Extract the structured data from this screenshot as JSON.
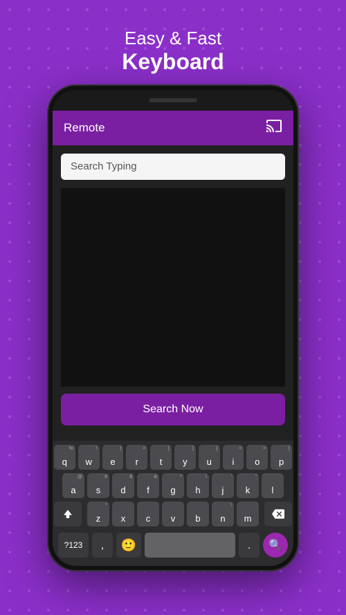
{
  "header": {
    "line1": "Easy & Fast",
    "line2": "Keyboard"
  },
  "appBar": {
    "title": "Remote"
  },
  "searchInput": {
    "placeholder": "Search Typing"
  },
  "searchButton": {
    "label": "Search Now"
  },
  "keyboard": {
    "row1": [
      {
        "label": "q",
        "sub": "%"
      },
      {
        "label": "w",
        "sub": "\\"
      },
      {
        "label": "e",
        "sub": "|"
      },
      {
        "label": "r",
        "sub": "="
      },
      {
        "label": "t",
        "sub": "["
      },
      {
        "label": "y",
        "sub": "]"
      },
      {
        "label": "u",
        "sub": "{"
      },
      {
        "label": "i",
        "sub": "<"
      },
      {
        "label": "o",
        "sub": ">"
      },
      {
        "label": "p",
        "sub": "}"
      }
    ],
    "row2": [
      {
        "label": "a",
        "sub": "@"
      },
      {
        "label": "s",
        "sub": "#"
      },
      {
        "label": "d",
        "sub": "$"
      },
      {
        "label": "f",
        "sub": "&"
      },
      {
        "label": "g",
        "sub": "*"
      },
      {
        "label": "h",
        "sub": "\\"
      },
      {
        "label": "j",
        "sub": "'"
      },
      {
        "label": "k",
        "sub": "\""
      },
      {
        "label": "l",
        "sub": ""
      }
    ],
    "row3": [
      {
        "label": "z",
        "sub": "*"
      },
      {
        "label": "x",
        "sub": ""
      },
      {
        "label": "c",
        "sub": ""
      },
      {
        "label": "v",
        "sub": ""
      },
      {
        "label": "b",
        "sub": ""
      },
      {
        "label": "n",
        "sub": "!"
      },
      {
        "label": "m",
        "sub": ""
      }
    ],
    "bottomRow": {
      "num": "?123",
      "comma": ",",
      "period": ".",
      "searchIcon": "🔍"
    }
  },
  "colors": {
    "purple": "#8B2FC9",
    "darkPurple": "#7B1FA2",
    "black": "#111111"
  }
}
